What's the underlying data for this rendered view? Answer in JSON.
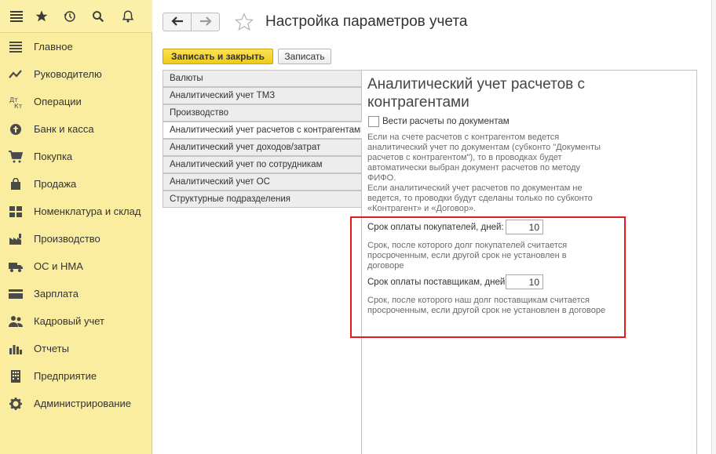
{
  "header": {
    "title": "Настройка параметров учета",
    "save_close_label": "Записать и закрыть",
    "save_label": "Записать"
  },
  "sidebar": {
    "items": [
      {
        "label": "Главное",
        "icon": "menu-lines-icon"
      },
      {
        "label": "Руководителю",
        "icon": "trend-line-icon"
      },
      {
        "label": "Операции",
        "icon": "debit-credit-icon"
      },
      {
        "label": "Банк и касса",
        "icon": "coin-icon"
      },
      {
        "label": "Покупка",
        "icon": "cart-icon"
      },
      {
        "label": "Продажа",
        "icon": "bag-icon"
      },
      {
        "label": "Номенклатура и склад",
        "icon": "grid-icon"
      },
      {
        "label": "Производство",
        "icon": "factory-icon"
      },
      {
        "label": "ОС и НМА",
        "icon": "truck-icon"
      },
      {
        "label": "Зарплата",
        "icon": "card-icon"
      },
      {
        "label": "Кадровый учет",
        "icon": "people-icon"
      },
      {
        "label": "Отчеты",
        "icon": "bar-chart-icon"
      },
      {
        "label": "Предприятие",
        "icon": "building-icon"
      },
      {
        "label": "Администрирование",
        "icon": "gear-icon"
      }
    ]
  },
  "tabs": [
    {
      "label": "Валюты",
      "active": false
    },
    {
      "label": "Аналитический учет ТМЗ",
      "active": false
    },
    {
      "label": "Производство",
      "active": false
    },
    {
      "label": "Аналитический учет расчетов с контрагентами",
      "active": true
    },
    {
      "label": "Аналитический учет доходов/затрат",
      "active": false
    },
    {
      "label": "Аналитический учет по сотрудникам",
      "active": false
    },
    {
      "label": "Аналитический учет ОС",
      "active": false
    },
    {
      "label": "Структурные подразделения",
      "active": false
    }
  ],
  "content": {
    "title": "Аналитический учет расчетов с контрагентами",
    "checkbox_label": "Вести расчеты по документам",
    "checkbox_checked": false,
    "hint1_lines": [
      "Если на счете расчетов с контрагентом ведется",
      "аналитический учет по документам (субконто \"Документы",
      "расчетов с контрагентом\"), то в проводках будет",
      "автоматически выбран  документ расчетов по методу",
      "ФИФО.",
      "Если аналитический учет расчетов по документам не",
      "ведется, то проводки будут сделаны только по субконто",
      "«Контрагент» и «Договор»."
    ],
    "buyers_label": "Срок оплаты покупателей, дней:",
    "buyers_value": "10",
    "buyers_hint_lines": [
      "Срок, после которого долг покупателей считается",
      "просроченным, если другой срок не установлен в",
      "договоре"
    ],
    "suppliers_label": "Срок оплаты поставщикам, дней:",
    "suppliers_value": "10",
    "suppliers_hint_lines": [
      "Срок, после которого наш долг поставщикам считается",
      "просроченным, если другой срок не установлен в договоре"
    ]
  },
  "colors": {
    "sidebar_bg": "#fbeda0",
    "primary_button": "#f3d12c",
    "highlight_border": "#e31b1b",
    "hint_text": "#6b6b6b"
  }
}
